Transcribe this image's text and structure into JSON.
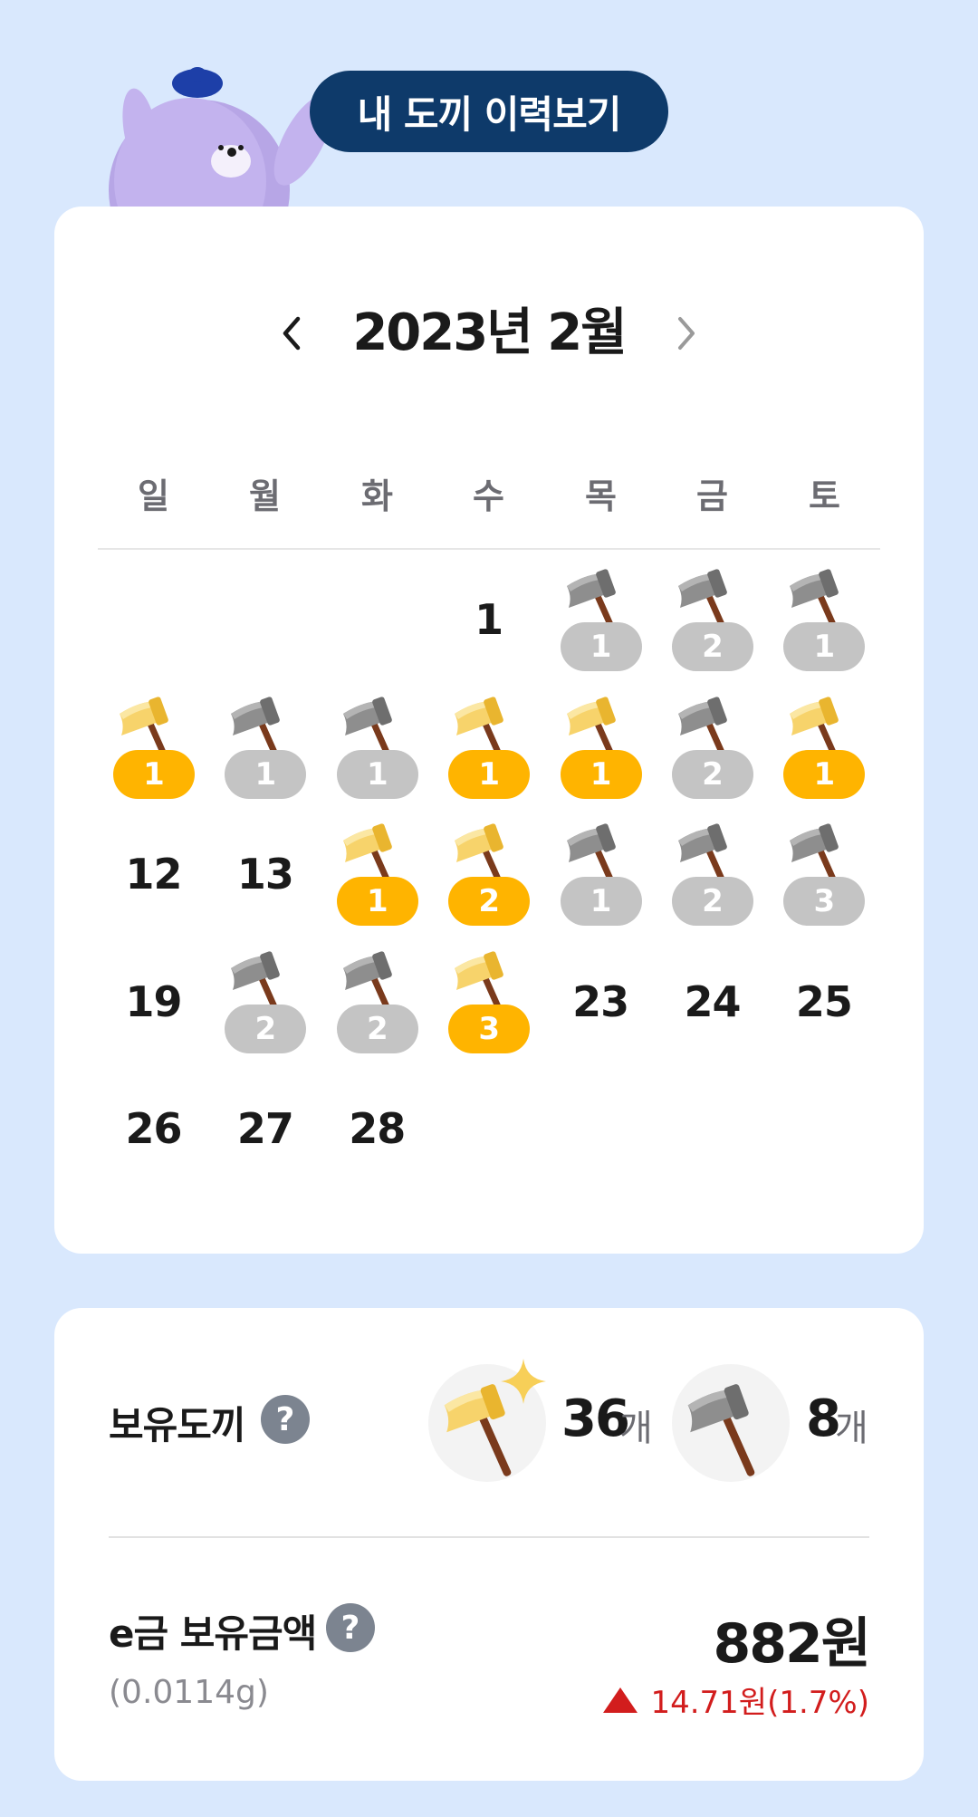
{
  "header": {
    "history_button": "내 도끼 이력보기"
  },
  "calendar": {
    "title": "2023년 2월",
    "weekdays": [
      "일",
      "월",
      "화",
      "수",
      "목",
      "금",
      "토"
    ],
    "days": [
      {
        "day": "1",
        "axe": null,
        "count": null
      },
      {
        "day": "2",
        "axe": "silver",
        "count": "1"
      },
      {
        "day": "3",
        "axe": "silver",
        "count": "2"
      },
      {
        "day": "4",
        "axe": "silver",
        "count": "1"
      },
      {
        "day": "5",
        "axe": "gold",
        "count": "1"
      },
      {
        "day": "6",
        "axe": "silver",
        "count": "1"
      },
      {
        "day": "7",
        "axe": "silver",
        "count": "1"
      },
      {
        "day": "8",
        "axe": "gold",
        "count": "1"
      },
      {
        "day": "9",
        "axe": "gold",
        "count": "1"
      },
      {
        "day": "10",
        "axe": "silver",
        "count": "2"
      },
      {
        "day": "11",
        "axe": "gold",
        "count": "1"
      },
      {
        "day": "12",
        "axe": null,
        "count": null
      },
      {
        "day": "13",
        "axe": null,
        "count": null
      },
      {
        "day": "14",
        "axe": "gold",
        "count": "1"
      },
      {
        "day": "15",
        "axe": "gold",
        "count": "2"
      },
      {
        "day": "16",
        "axe": "silver",
        "count": "1"
      },
      {
        "day": "17",
        "axe": "silver",
        "count": "2"
      },
      {
        "day": "18",
        "axe": "silver",
        "count": "3"
      },
      {
        "day": "19",
        "axe": null,
        "count": null
      },
      {
        "day": "20",
        "axe": "silver",
        "count": "2"
      },
      {
        "day": "21",
        "axe": "silver",
        "count": "2"
      },
      {
        "day": "22",
        "axe": "gold",
        "count": "3"
      },
      {
        "day": "23",
        "axe": null,
        "count": null
      },
      {
        "day": "24",
        "axe": null,
        "count": null
      },
      {
        "day": "25",
        "axe": null,
        "count": null
      },
      {
        "day": "26",
        "axe": null,
        "count": null
      },
      {
        "day": "27",
        "axe": null,
        "count": null
      },
      {
        "day": "28",
        "axe": null,
        "count": null
      }
    ]
  },
  "summary": {
    "axes_label": "보유도끼",
    "help": "?",
    "gold_axes_count": "36",
    "silver_axes_count": "8",
    "unit": "개",
    "egold_label": "e금 보유금액",
    "egold_amount": "882원",
    "egold_grams": "(0.0114g)",
    "egold_change": "14.71원(1.7%)"
  },
  "colors": {
    "gold_badge": "#ffb400",
    "silver_badge": "#c4c4c4",
    "header_pill": "#0e3a6a",
    "background": "#d9e8fd",
    "up_red": "#d21d1d"
  },
  "icons": {
    "gold_axe": "gold-axe-icon",
    "silver_axe": "silver-axe-icon",
    "prev": "chevron-left-icon",
    "next": "chevron-right-icon",
    "help": "question-circle-icon",
    "up": "triangle-up-icon"
  }
}
